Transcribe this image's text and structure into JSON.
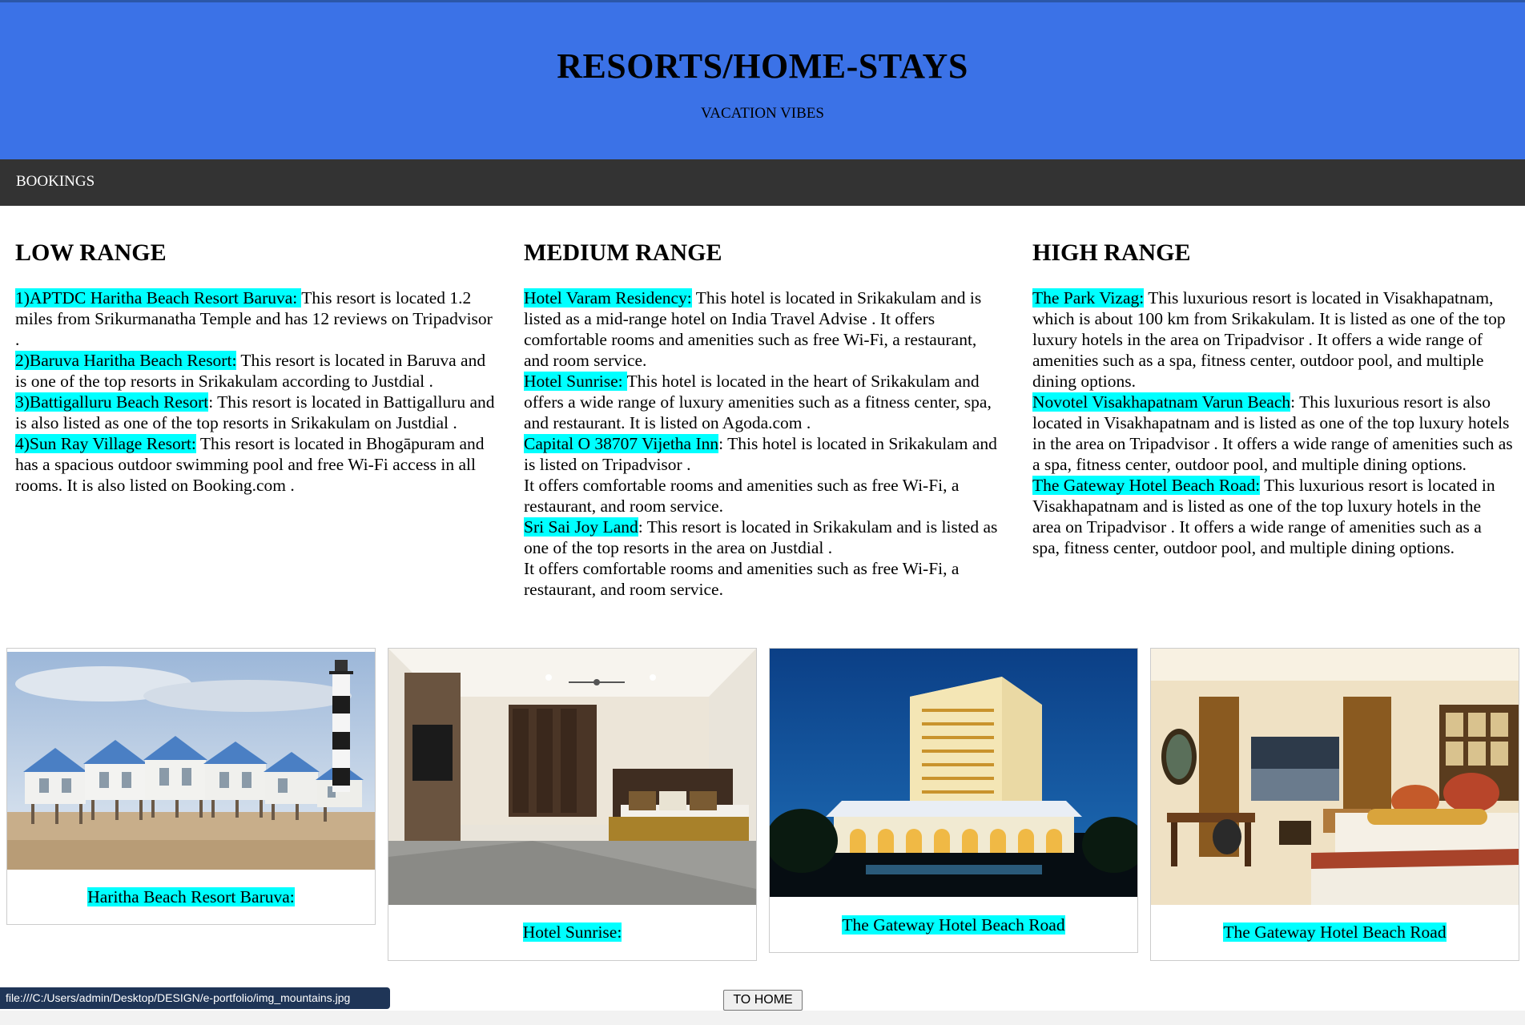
{
  "header": {
    "title": "RESORTS/HOME-STAYS",
    "subtitle": "VACATION VIBES"
  },
  "nav": {
    "bookings": "BOOKINGS"
  },
  "columns": [
    {
      "heading": "LOW RANGE",
      "entries": [
        {
          "name": "1)APTDC Haritha Beach Resort Baruva: ",
          "text": "This resort is located 1.2 miles from Srikurmanatha Temple and has 12 reviews on Tripadvisor ."
        },
        {
          "name": "2)Baruva Haritha Beach Resort:",
          "text": " This resort is located in Baruva and is one of the top resorts in Srikakulam according to Justdial ."
        },
        {
          "name": "3)Battigalluru Beach Resort",
          "text": ": This resort is located in Battigalluru and is also listed as one of the top resorts in Srikakulam on Justdial ."
        },
        {
          "name": "4)Sun Ray Village Resort:",
          "text": " This resort is located in Bhogāpuram and has a spacious outdoor swimming pool and free Wi-Fi access in all rooms. It is also listed on Booking.com ."
        }
      ]
    },
    {
      "heading": "MEDIUM RANGE",
      "entries": [
        {
          "name": "Hotel Varam Residency:",
          "text": " This hotel is located in Srikakulam and is listed as a mid-range hotel on India Travel Advise . It offers comfortable rooms and amenities such as free Wi-Fi, a restaurant, and room service."
        },
        {
          "name": "Hotel Sunrise: ",
          "text": "This hotel is located in the heart of Srikakulam and offers a wide range of luxury amenities such as a fitness center, spa, and restaurant. It is listed on Agoda.com ."
        },
        {
          "name": "Capital O 38707 Vijetha Inn",
          "text": ": This hotel is located in Srikakulam and is listed on Tripadvisor .",
          "extra": "It offers comfortable rooms and amenities such as free Wi-Fi, a restaurant, and room service."
        },
        {
          "name": "Sri Sai Joy Land",
          "text": ": This resort is located in Srikakulam and is listed as one of the top resorts in the area on Justdial .",
          "extra": "It offers comfortable rooms and amenities such as free Wi-Fi, a restaurant, and room service."
        }
      ]
    },
    {
      "heading": "HIGH RANGE",
      "entries": [
        {
          "name": "The Park Vizag:",
          "text": " This luxurious resort is located in Visakhapatnam, which is about 100 km from Srikakulam. It is listed as one of the top luxury hotels in the area on Tripadvisor . It offers a wide range of amenities such as a spa, fitness center, outdoor pool, and multiple dining options."
        },
        {
          "name": "Novotel Visakhapatnam Varun Beach",
          "text": ": This luxurious resort is also located in Visakhapatnam and is listed as one of the top luxury hotels in the area on Tripadvisor . It offers a wide range of amenities such as a spa, fitness center, outdoor pool, and multiple dining options."
        },
        {
          "name": "The Gateway Hotel Beach Road:",
          "text": " This luxurious resort is located in Visakhapatnam and is listed as one of the top luxury hotels in the area on Tripadvisor . It offers a wide range of amenities such as a spa, fitness center, outdoor pool, and multiple dining options."
        }
      ]
    }
  ],
  "gallery": [
    {
      "caption": "Haritha Beach Resort Baruva:"
    },
    {
      "caption": "Hotel Sunrise:"
    },
    {
      "caption": "The Gateway Hotel Beach Road"
    },
    {
      "caption": "The Gateway Hotel Beach Road"
    }
  ],
  "status_bar": "file:///C:/Users/admin/Desktop/DESIGN/e-portfolio/img_mountains.jpg",
  "to_home": "TO HOME"
}
